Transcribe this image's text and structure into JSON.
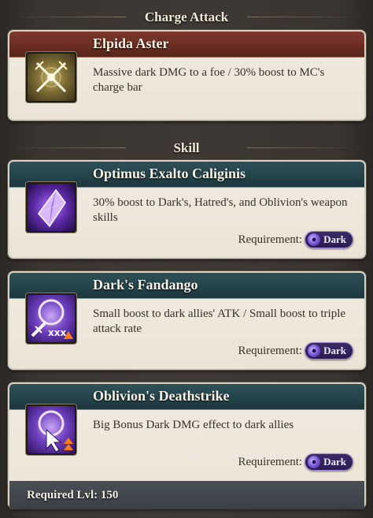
{
  "charge_attack": {
    "section_title": "Charge Attack",
    "name": "Elpida Aster",
    "description": "Massive dark DMG to a foe / 30% boost to MC's charge bar",
    "icon": "crossed-swords-icon"
  },
  "skill": {
    "section_title": "Skill",
    "requirement_label": "Requirement:",
    "items": [
      {
        "name": "Optimus Exalto Caliginis",
        "description": "30% boost to Dark's, Hatred's, and Oblivion's weapon skills",
        "requirement": "Dark",
        "icon": "dark-crystal-icon"
      },
      {
        "name": "Dark's Fandango",
        "description": "Small boost to dark allies' ATK / Small boost to triple attack rate",
        "requirement": "Dark",
        "icon": "dark-sword-triple-attack-icon"
      },
      {
        "name": "Oblivion's Deathstrike",
        "description": "Big Bonus Dark DMG effect to dark allies",
        "requirement": "Dark",
        "icon": "dark-cursor-boost-icon"
      }
    ]
  },
  "footer": {
    "required_level": "Required Lvl: 150"
  },
  "colors": {
    "charge_title": "#6a2c22",
    "skill_title": "#24434a",
    "dark_badge": "#2a1c4f",
    "card_body": "#ede6da"
  }
}
